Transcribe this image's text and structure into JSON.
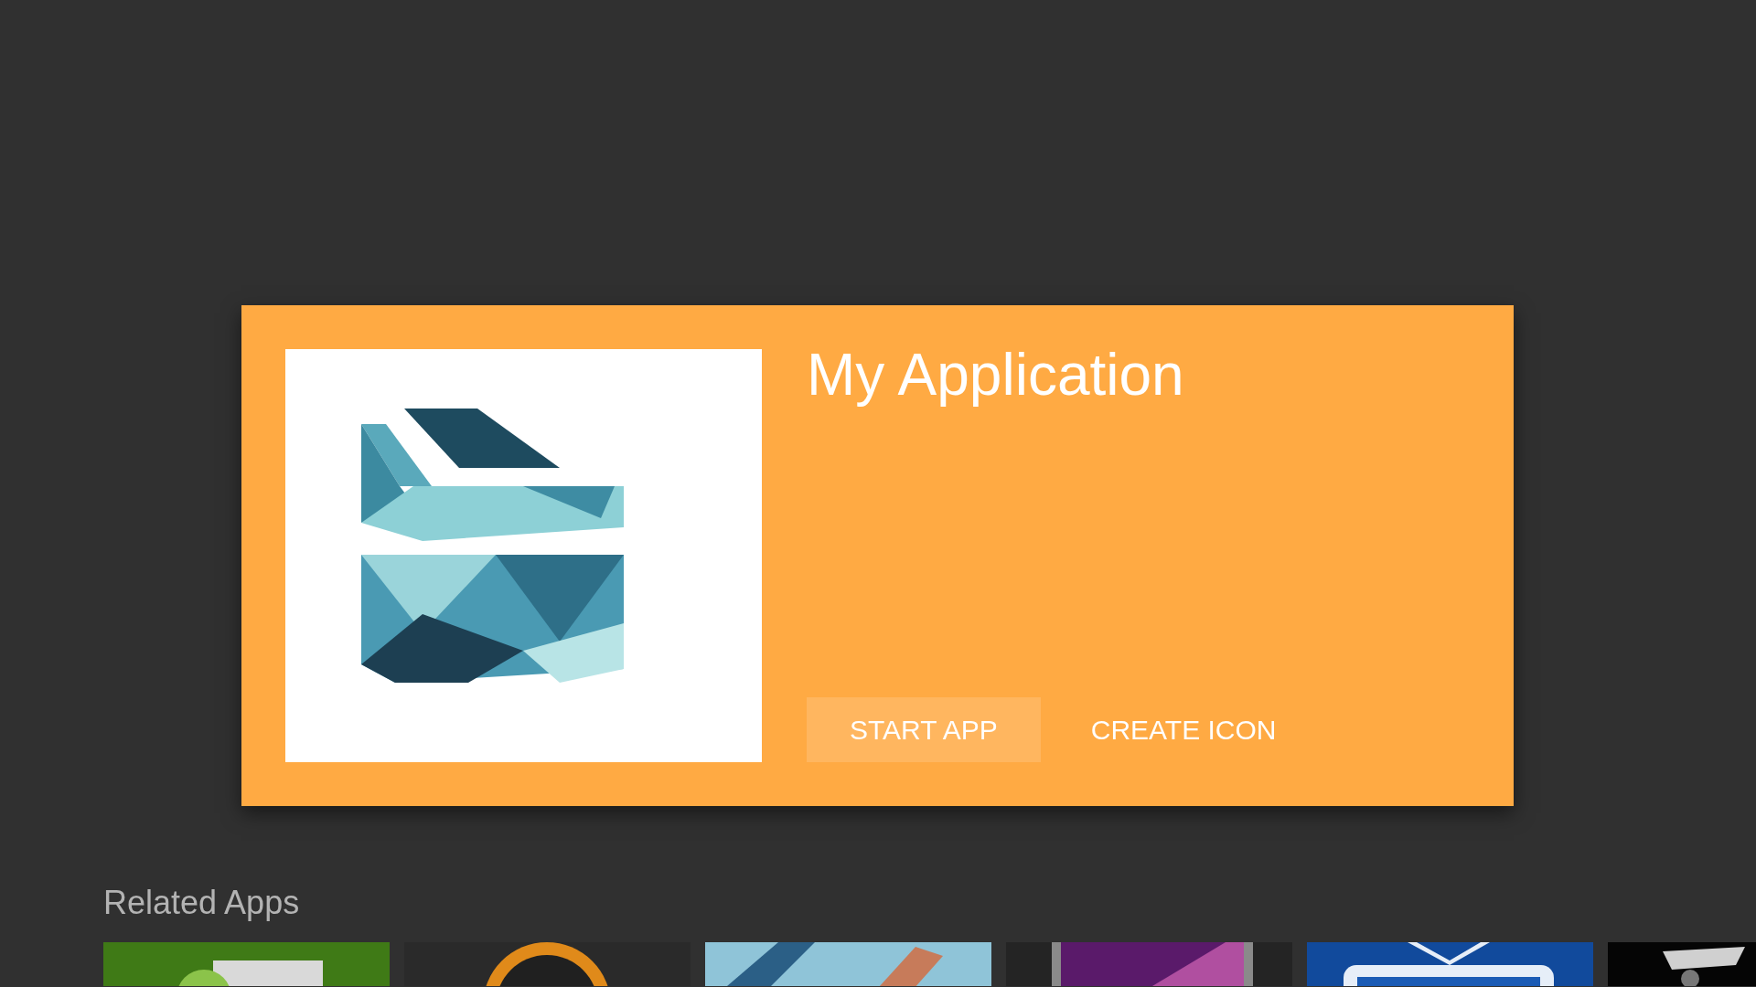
{
  "details": {
    "title": "My Application",
    "actions": [
      {
        "label": "START APP",
        "selected": true
      },
      {
        "label": "CREATE ICON",
        "selected": false
      }
    ]
  },
  "related_apps": {
    "title": "Related Apps"
  }
}
